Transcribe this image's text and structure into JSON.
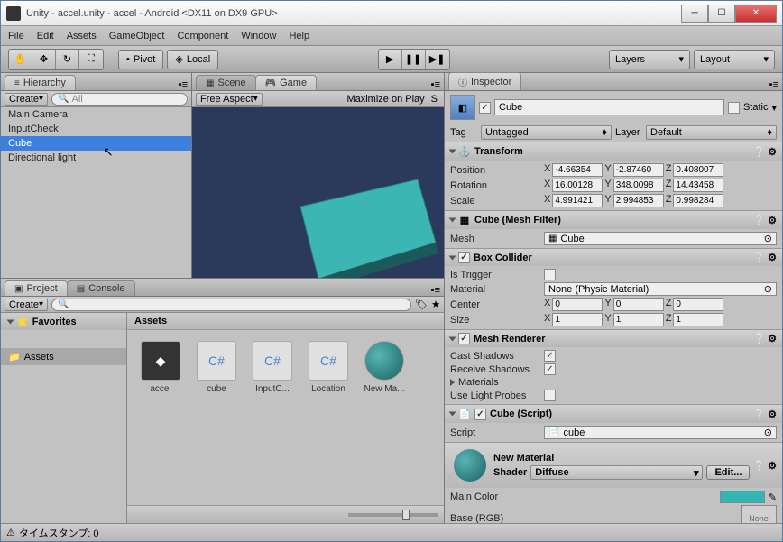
{
  "window": {
    "title": "Unity - accel.unity - accel - Android <DX11 on DX9 GPU>"
  },
  "menu": {
    "file": "File",
    "edit": "Edit",
    "assets": "Assets",
    "gameobject": "GameObject",
    "component": "Component",
    "window": "Window",
    "help": "Help"
  },
  "toolbar": {
    "pivot": "Pivot",
    "local": "Local",
    "layers": "Layers",
    "layout": "Layout"
  },
  "hierarchy": {
    "tab": "Hierarchy",
    "create": "Create",
    "search_placeholder": "All",
    "items": [
      "Main Camera",
      "InputCheck",
      "Cube",
      "Directional light"
    ],
    "selected_index": 2
  },
  "scene": {
    "scene_tab": "Scene",
    "game_tab": "Game",
    "free_aspect": "Free Aspect",
    "maximize": "Maximize on Play",
    "stats": "S"
  },
  "project": {
    "project_tab": "Project",
    "console_tab": "Console",
    "create": "Create",
    "favorites": "Favorites",
    "assets": "Assets",
    "assets_header": "Assets",
    "items": [
      {
        "name": "accel",
        "type": "unity"
      },
      {
        "name": "cube",
        "type": "cs"
      },
      {
        "name": "InputC...",
        "type": "cs"
      },
      {
        "name": "Location",
        "type": "cs"
      },
      {
        "name": "New Ma...",
        "type": "material"
      }
    ]
  },
  "inspector": {
    "tab": "Inspector",
    "name": "Cube",
    "static": "Static",
    "tag_label": "Tag",
    "tag_value": "Untagged",
    "layer_label": "Layer",
    "layer_value": "Default",
    "transform": {
      "title": "Transform",
      "position": "Position",
      "rotation": "Rotation",
      "scale": "Scale",
      "pos_x": "-4.66354",
      "pos_y": "-2.87460",
      "pos_z": "0.408007",
      "rot_x": "16.00128",
      "rot_y": "348.0098",
      "rot_z": "14.43458",
      "scl_x": "4.991421",
      "scl_y": "2.994853",
      "scl_z": "0.998284"
    },
    "meshfilter": {
      "title": "Cube (Mesh Filter)",
      "mesh_label": "Mesh",
      "mesh_value": "Cube"
    },
    "boxcollider": {
      "title": "Box Collider",
      "is_trigger": "Is Trigger",
      "material": "Material",
      "material_value": "None (Physic Material)",
      "center": "Center",
      "cx": "0",
      "cy": "0",
      "cz": "0",
      "size": "Size",
      "sx": "1",
      "sy": "1",
      "sz": "1"
    },
    "meshrenderer": {
      "title": "Mesh Renderer",
      "cast": "Cast Shadows",
      "receive": "Receive Shadows",
      "materials": "Materials",
      "probes": "Use Light Probes"
    },
    "script": {
      "title": "Cube (Script)",
      "script_label": "Script",
      "script_value": "cube"
    },
    "material": {
      "title": "New Material",
      "shader_label": "Shader",
      "shader_value": "Diffuse",
      "edit": "Edit...",
      "main_color": "Main Color",
      "base_rgb": "Base (RGB)",
      "none_texture": "None"
    }
  },
  "status": {
    "text": "タイムスタンプ: 0"
  }
}
